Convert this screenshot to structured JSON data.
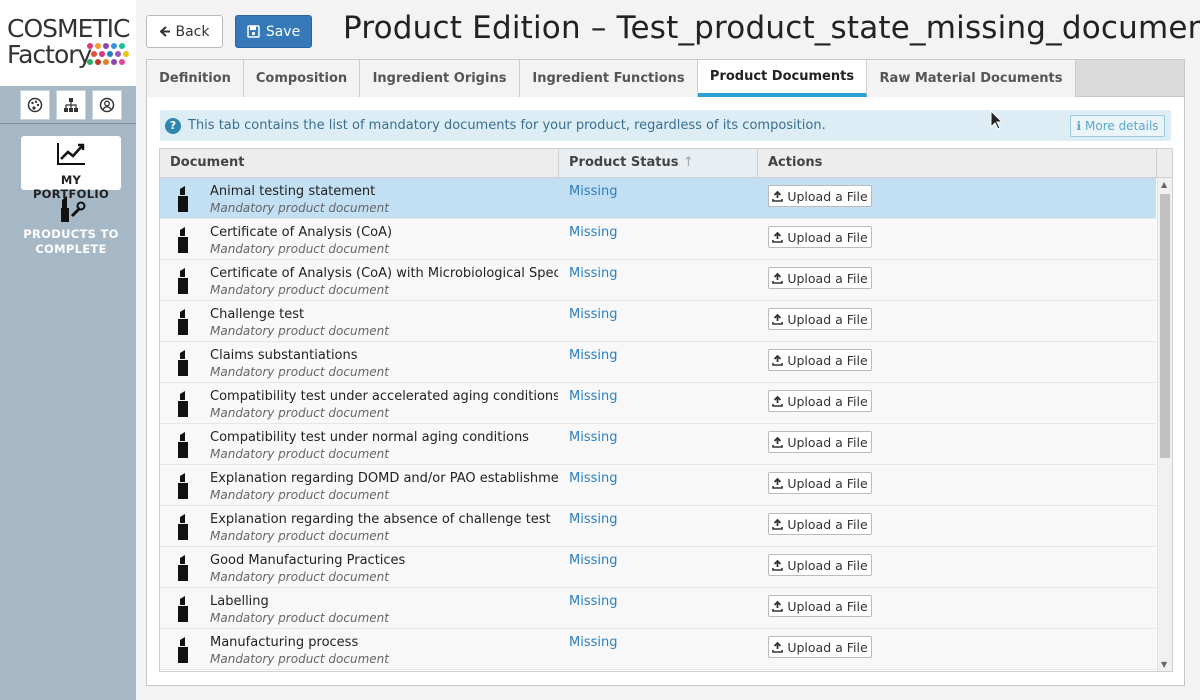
{
  "logo": {
    "line1": "COSMETIC",
    "line2": "Factory"
  },
  "sidebar": {
    "top_icons": [
      "palette-icon",
      "sitemap-icon",
      "user-circle-icon"
    ],
    "nav": [
      {
        "label": "MY PORTFOLIO",
        "icon": "chart-line-icon",
        "active": true
      },
      {
        "label": "PRODUCTS TO COMPLETE",
        "icon": "lipstick-wrench-icon",
        "active": false
      }
    ]
  },
  "header": {
    "back_label": "Back",
    "save_label": "Save",
    "title": "Product Edition – Test_product_state_missing_document"
  },
  "tabs": [
    {
      "label": "Definition",
      "active": false
    },
    {
      "label": "Composition",
      "active": false
    },
    {
      "label": "Ingredient Origins",
      "active": false
    },
    {
      "label": "Ingredient Functions",
      "active": false
    },
    {
      "label": "Product Documents",
      "active": true
    },
    {
      "label": "Raw Material Documents",
      "active": false
    }
  ],
  "info": {
    "text": "This tab contains the list of mandatory documents for your product, regardless of its composition.",
    "more_label": "More details"
  },
  "table": {
    "columns": [
      "Document",
      "Product Status",
      "Actions"
    ],
    "sorted_column": "Product Status",
    "upload_label": "Upload a File",
    "rows": [
      {
        "name": "Animal testing statement",
        "sub": "Mandatory product document",
        "status": "Missing",
        "selected": true
      },
      {
        "name": "Certificate of Analysis (CoA)",
        "sub": "Mandatory product document",
        "status": "Missing"
      },
      {
        "name": "Certificate of Analysis (CoA) with Microbiological Spec",
        "sub": "Mandatory product document",
        "status": "Missing"
      },
      {
        "name": "Challenge test",
        "sub": "Mandatory product document",
        "status": "Missing"
      },
      {
        "name": "Claims substantiations",
        "sub": "Mandatory product document",
        "status": "Missing"
      },
      {
        "name": "Compatibility test under accelerated aging conditions",
        "sub": "Mandatory product document",
        "status": "Missing"
      },
      {
        "name": "Compatibility test under normal aging conditions",
        "sub": "Mandatory product document",
        "status": "Missing"
      },
      {
        "name": "Explanation regarding DOMD and/or PAO establishme",
        "sub": "Mandatory product document",
        "status": "Missing"
      },
      {
        "name": "Explanation regarding the absence of challenge test",
        "sub": "Mandatory product document",
        "status": "Missing"
      },
      {
        "name": "Good Manufacturing Practices",
        "sub": "Mandatory product document",
        "status": "Missing"
      },
      {
        "name": "Labelling",
        "sub": "Mandatory product document",
        "status": "Missing"
      },
      {
        "name": "Manufacturing process",
        "sub": "Mandatory product document",
        "status": "Missing"
      }
    ]
  },
  "colors": {
    "accent": "#3579b8",
    "tab_underline": "#2f9fd3",
    "status_missing": "#2a7fc0",
    "sidebar": "#a6b7c6",
    "selected_row": "#c3dff3"
  }
}
